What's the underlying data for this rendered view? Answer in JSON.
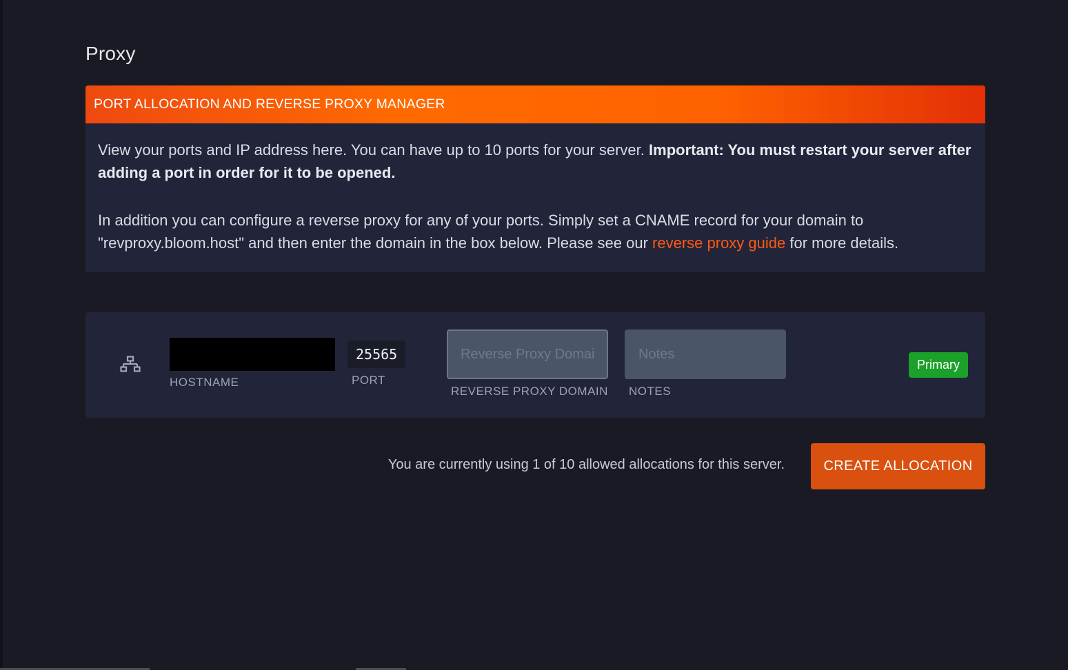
{
  "page": {
    "title": "Proxy"
  },
  "notice": {
    "header": "PORT ALLOCATION AND REVERSE PROXY MANAGER",
    "p1_text": "View your ports and IP address here. You can have up to 10 ports for your server. ",
    "p1_bold": "Important: You must restart your server after adding a port in order for it to be opened.",
    "p2_text_before_link": "In addition you can configure a reverse proxy for any of your ports. Simply set a CNAME record for your domain to \"revproxy.bloom.host\" and then enter the domain in the box below. Please see our ",
    "p2_link": "reverse proxy guide",
    "p2_text_after_link": " for more details."
  },
  "allocation": {
    "icon": "network-icon",
    "hostname_label": "HOSTNAME",
    "port_value": "25565",
    "port_label": "PORT",
    "reverse_proxy_placeholder": "Reverse Proxy Domain",
    "reverse_proxy_label": "REVERSE PROXY DOMAIN",
    "notes_placeholder": "Notes",
    "notes_label": "NOTES",
    "badge": "Primary"
  },
  "footer": {
    "usage_text": "You are currently using 1 of 10 allowed allocations for this server.",
    "create_button": "CREATE ALLOCATION"
  },
  "colors": {
    "background": "#191a24",
    "card": "#22243a",
    "accent": "#ff6a00",
    "link": "#ff5a12",
    "button": "#d9500f",
    "badge": "#1ba02a"
  }
}
